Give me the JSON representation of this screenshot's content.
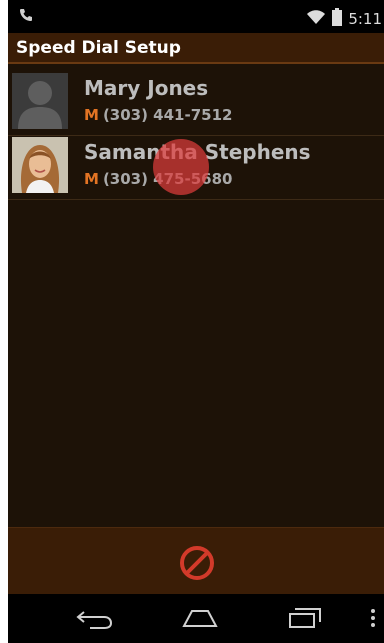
{
  "status_bar": {
    "time": "5:11",
    "left_icon": "phone-handset-icon",
    "wifi_icon": "wifi-icon",
    "battery_icon": "battery-icon"
  },
  "header": {
    "title": "Speed Dial Setup"
  },
  "contacts": [
    {
      "name": "Mary Jones",
      "phone_type": "M",
      "phone": "(303) 441-7512",
      "avatar": "default-contact-avatar-icon"
    },
    {
      "name": "Samantha Stephens",
      "phone_type": "M",
      "phone": "(303) 475-5680",
      "avatar": "contact-photo"
    }
  ],
  "action_bar": {
    "cancel_icon": "cancel-prohibit-icon"
  },
  "nav_bar": {
    "back_icon": "back-icon",
    "home_icon": "home-icon",
    "recents_icon": "recents-icon",
    "menu_icon": "overflow-menu-icon"
  },
  "colors": {
    "title_bar": "#3a1d06",
    "content_bg": "#1d1207",
    "accent_orange": "#e37424",
    "cancel_red": "#d23a2a",
    "touch_indicator": "#dc3c3c"
  }
}
